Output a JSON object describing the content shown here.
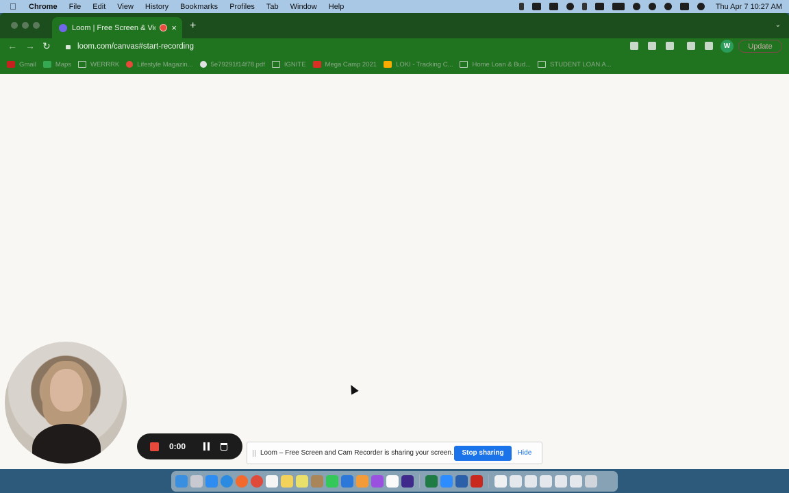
{
  "menubar": {
    "app_name": "Chrome",
    "items": [
      "File",
      "Edit",
      "View",
      "History",
      "Bookmarks",
      "Profiles",
      "Tab",
      "Window",
      "Help"
    ],
    "clock": "Thu Apr 7  10:27 AM"
  },
  "browser": {
    "tab_title": "Loom | Free Screen & Vide",
    "tab_close": "×",
    "new_tab": "+",
    "tab_menu": "⌄",
    "back": "←",
    "forward": "→",
    "reload": "↻",
    "url": "loom.com/canvas#start-recording",
    "profile_initial": "W",
    "update_label": "Update"
  },
  "bookmarks": [
    {
      "label": "Gmail",
      "icon": "gmail-icon",
      "color": "#c5221f"
    },
    {
      "label": "Maps",
      "icon": "maps-icon",
      "color": "#34a853"
    },
    {
      "label": "WERRRK",
      "icon": "folder-icon",
      "color": ""
    },
    {
      "label": "Lifestyle Magazin...",
      "icon": "circle-icon",
      "color": "#e8493a"
    },
    {
      "label": "5e79291f14f78.pdf",
      "icon": "globe-icon",
      "color": "#e0e0e0"
    },
    {
      "label": "IGNITE",
      "icon": "folder-icon",
      "color": ""
    },
    {
      "label": "Mega Camp 2021",
      "icon": "picture-icon",
      "color": "#d93025"
    },
    {
      "label": "LOKI - Tracking C...",
      "icon": "house-icon",
      "color": "#f9ab00"
    },
    {
      "label": "Home Loan & Bud...",
      "icon": "folder-icon",
      "color": ""
    },
    {
      "label": "STUDENT LOAN A...",
      "icon": "folder-icon",
      "color": ""
    }
  ],
  "loom": {
    "timer": "0:00",
    "share_message": "Loom – Free Screen and Cam Recorder is sharing your screen.",
    "stop_sharing": "Stop sharing",
    "hide": "Hide"
  },
  "colors": {
    "chrome_theme": "#21741f",
    "record_red": "#e8493a",
    "stop_sharing_blue": "#1a73e8"
  },
  "dock_apps": [
    "finder-icon",
    "launchpad-icon",
    "app-store-icon",
    "safari-icon",
    "firefox-icon",
    "chrome-icon",
    "notes-icon",
    "files-icon",
    "stickies-icon",
    "photos-icon",
    "messages-icon",
    "keynote-icon",
    "pages-icon",
    "podcasts-icon",
    "slack-icon",
    "amazon-music-icon",
    "excel-icon",
    "zoom-icon",
    "word-icon",
    "acrobat-icon",
    "document-icon",
    "window-icon",
    "window-icon",
    "window-icon",
    "window-icon",
    "window-icon",
    "trash-icon"
  ]
}
